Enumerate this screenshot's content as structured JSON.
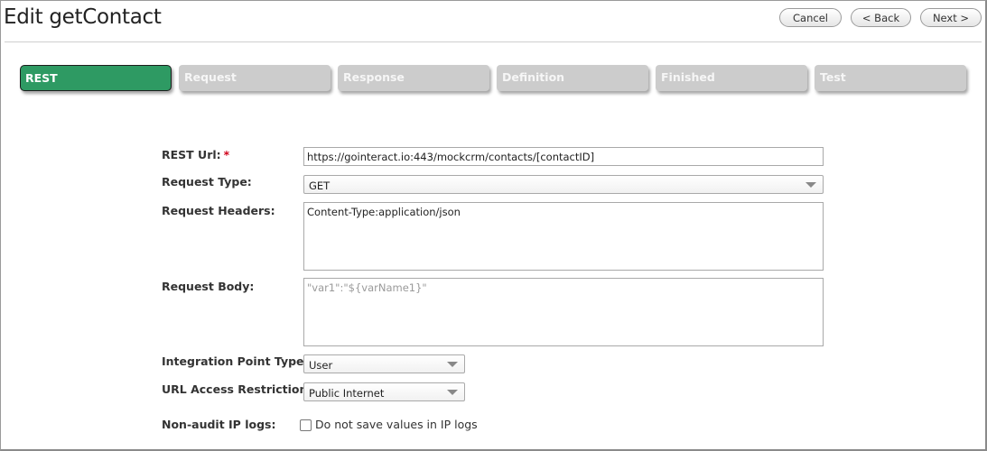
{
  "header": {
    "title": "Edit getContact",
    "cancel_label": "Cancel",
    "back_label": "< Back",
    "next_label": "Next >"
  },
  "steps": [
    {
      "label": "REST",
      "active": true
    },
    {
      "label": "Request",
      "active": false
    },
    {
      "label": "Response",
      "active": false
    },
    {
      "label": "Definition",
      "active": false
    },
    {
      "label": "Finished",
      "active": false
    },
    {
      "label": "Test",
      "active": false
    }
  ],
  "form": {
    "rest_url": {
      "label": "REST Url:",
      "required_mark": "*",
      "value": "https://gointeract.io:443/mockcrm/contacts/[contactID]"
    },
    "request_type": {
      "label": "Request Type:",
      "value": "GET"
    },
    "request_headers": {
      "label": "Request Headers:",
      "value": "Content-Type:application/json"
    },
    "request_body": {
      "label": "Request Body:",
      "placeholder": "\"var1\":\"${varName1}\""
    },
    "integration_point_type": {
      "label": "Integration Point Type:",
      "value": "User"
    },
    "url_access_restriction": {
      "label": "URL Access Restriction:",
      "value": "Public Internet"
    },
    "non_audit_ip_logs": {
      "label": "Non-audit IP logs:",
      "checkbox_label": "Do not save values in IP logs",
      "checked": false
    }
  },
  "colors": {
    "active_step": "#2e9a63",
    "inactive_step": "#cccccc",
    "required": "#d0021b"
  }
}
